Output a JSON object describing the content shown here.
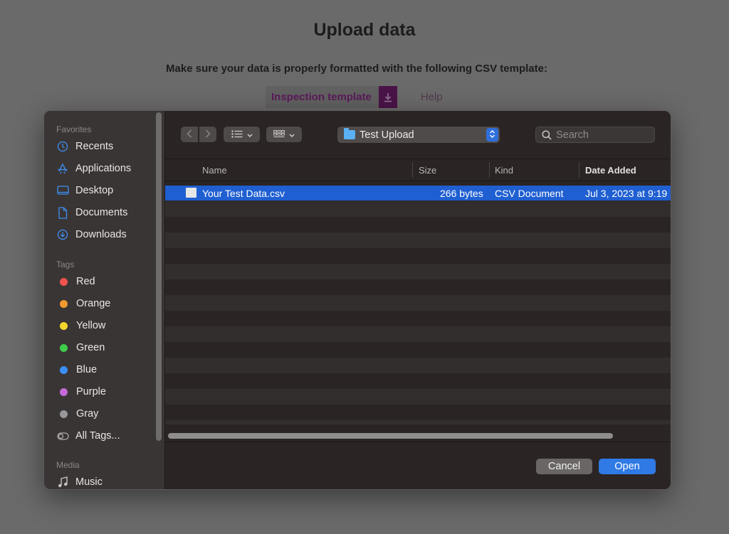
{
  "page": {
    "title": "Upload data",
    "subtitle": "Make sure your data is properly formatted with the following CSV template:",
    "template_button": "Inspection template",
    "help_link": "Help"
  },
  "dialog": {
    "sidebar": {
      "favorites_label": "Favorites",
      "favorites": [
        {
          "label": "Recents",
          "icon": "clock-icon"
        },
        {
          "label": "Applications",
          "icon": "applications-icon"
        },
        {
          "label": "Desktop",
          "icon": "desktop-icon"
        },
        {
          "label": "Documents",
          "icon": "document-icon"
        },
        {
          "label": "Downloads",
          "icon": "download-icon"
        }
      ],
      "tags_label": "Tags",
      "tags": [
        {
          "label": "Red",
          "color": "#f0534d"
        },
        {
          "label": "Orange",
          "color": "#f29a2e"
        },
        {
          "label": "Yellow",
          "color": "#f5d52d"
        },
        {
          "label": "Green",
          "color": "#3fcc4c"
        },
        {
          "label": "Blue",
          "color": "#3a8ff3"
        },
        {
          "label": "Purple",
          "color": "#c46ad9"
        },
        {
          "label": "Gray",
          "color": "#98979a"
        }
      ],
      "all_tags": "All Tags...",
      "media_label": "Media",
      "media": [
        {
          "label": "Music",
          "icon": "music-note-icon"
        }
      ]
    },
    "toolbar": {
      "location": "Test Upload",
      "search_placeholder": "Search"
    },
    "columns": {
      "name": "Name",
      "size": "Size",
      "kind": "Kind",
      "date_added": "Date Added"
    },
    "files": [
      {
        "name": "Your Test Data.csv",
        "size": "266 bytes",
        "kind": "CSV Document",
        "date_added": "Jul 3, 2023 at 9:19"
      }
    ],
    "buttons": {
      "cancel": "Cancel",
      "open": "Open"
    },
    "accent_color": "#1f5fd1"
  }
}
